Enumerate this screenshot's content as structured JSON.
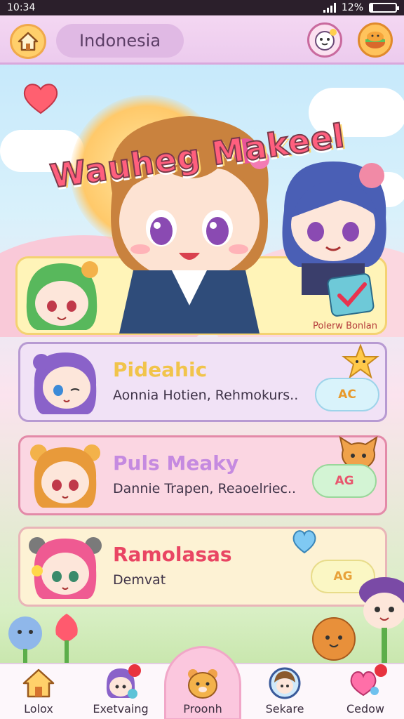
{
  "status_bar": {
    "time": "10:34",
    "battery": "12%",
    "battery_level": 0.12
  },
  "header": {
    "region": "Indonesia",
    "home_icon": "home-icon",
    "pet_icon": "pet-icon",
    "food_icon": "food-icon"
  },
  "banner": {
    "title": "Wauheg Makeel",
    "promo_label": "Polerw Bonlan"
  },
  "cards": [
    {
      "title": "Pideahic",
      "subtitle": "Aonnia Hotien, Rehmokurs..",
      "badge": "AC",
      "title_color": "#f1c44b",
      "bg": "#f1e2f6",
      "border": "#b79ad2"
    },
    {
      "title": "Puls Meaky",
      "subtitle": "Dannie Trapen, Reaoelriec..",
      "badge": "AG",
      "title_color": "#c58ae0",
      "bg": "#fbd6e2",
      "border": "#e38aa8"
    },
    {
      "title": "Ramolasas",
      "subtitle": "Demvat",
      "badge": "AG",
      "title_color": "#e94563",
      "bg": "#fdf2d4",
      "border": "#e9b5b8"
    }
  ],
  "nav": [
    {
      "label": "Lolox",
      "icon": "house-icon"
    },
    {
      "label": "Exetvaing",
      "icon": "character-icon"
    },
    {
      "label": "Proonh",
      "icon": "bear-icon",
      "active": true
    },
    {
      "label": "Sekare",
      "icon": "avatar-icon"
    },
    {
      "label": "Cedow",
      "icon": "heart-icon"
    }
  ],
  "colors": {
    "header_bg": "#f4d7f2",
    "accent": "#ff5f7e"
  }
}
